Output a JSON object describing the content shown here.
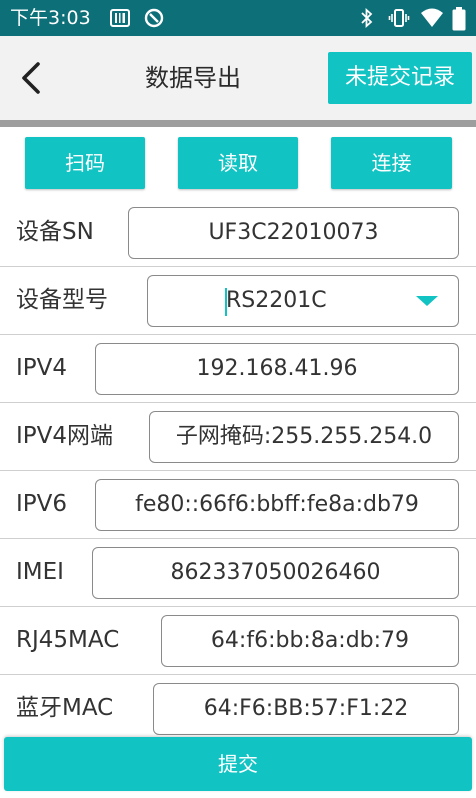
{
  "status_bar": {
    "time": "下午3:03",
    "icons": [
      "barcode-icon",
      "sync-icon",
      "bluetooth-icon",
      "vibrate-icon",
      "wifi-icon",
      "battery-icon"
    ]
  },
  "header": {
    "title": "数据导出",
    "records_button": "未提交记录"
  },
  "actions": {
    "scan": "扫码",
    "read": "读取",
    "connect": "连接"
  },
  "form": {
    "device_sn": {
      "label": "设备SN",
      "value": "UF3C22010073"
    },
    "device_model": {
      "label": "设备型号",
      "value": "RS2201C"
    },
    "ipv4": {
      "label": "IPV4",
      "value": "192.168.41.96"
    },
    "ipv4_mask": {
      "label": "IPV4网端",
      "value": "子网掩码:255.255.254.0"
    },
    "ipv6": {
      "label": "IPV6",
      "value": "fe80::66f6:bbff:fe8a:db79"
    },
    "imei": {
      "label": "IMEI",
      "value": "862337050026460"
    },
    "rj45_mac": {
      "label": "RJ45MAC",
      "value": "64:f6:bb:8a:db:79"
    },
    "bt_mac": {
      "label": "蓝牙MAC",
      "value": "64:F6:BB:57:F1:22"
    }
  },
  "submit_label": "提交",
  "colors": {
    "accent": "#12c3c3",
    "status_bar": "#0d6f78",
    "header_bg": "#f2f2f2"
  }
}
